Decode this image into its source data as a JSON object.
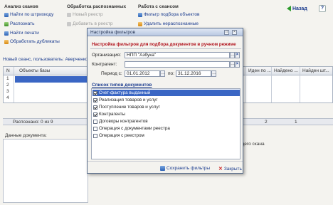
{
  "groups": [
    {
      "title": "Анализ сканов",
      "items": [
        "Найти по штрихкоду",
        "Распознать",
        "Найти печати",
        "Обработать дубликаты"
      ]
    },
    {
      "title": "Обработка распознанных",
      "items": [
        "Новый реестр",
        "Добавить в реестр"
      ]
    },
    {
      "title": "Работа с сеансом",
      "items": [
        "Фильтр подбора объектов",
        "Удалить нераспознанные"
      ]
    }
  ],
  "back": {
    "label": "Назад"
  },
  "help": {
    "label": "?"
  },
  "session": {
    "text": "Новый сеанс, пользователь: Аверченко А"
  },
  "grid": {
    "columns": [
      "N",
      "Объекты базы",
      "Иден по ...",
      "Найдено ...",
      "Найден шт..."
    ],
    "row_numbers": [
      "1",
      "2",
      "3",
      "4"
    ],
    "status": "Распознано: 0 из 9",
    "right_values": [
      "2",
      "1"
    ]
  },
  "data_label": "Данные документа:",
  "right_label": "щего скана",
  "dialog": {
    "title": "Настройка фильтров",
    "header": "Настройка фильтров для подбора документов в ручном режиме",
    "org_label": "Организация:",
    "org_value": "НПП \"Азбука\"",
    "contr_label": "Контрагент:",
    "contr_value": "",
    "period_label": "Период с:",
    "date_from": "01.01.2012",
    "po_label": "по:",
    "date_to": "31.12.2016",
    "list_title": "Список типов документов",
    "doc_types": [
      {
        "label": "Счет-фактура выданный",
        "checked": true,
        "selected": true
      },
      {
        "label": "Реализация товаров и услуг",
        "checked": true,
        "selected": false
      },
      {
        "label": "Поступление товаров и услуг",
        "checked": true,
        "selected": false
      },
      {
        "label": "Контрагенты",
        "checked": true,
        "selected": false
      },
      {
        "label": "Договоры контрагентов",
        "checked": false,
        "selected": false
      },
      {
        "label": "Операция с документами реестра",
        "checked": false,
        "selected": false
      },
      {
        "label": "Операция с реестром",
        "checked": false,
        "selected": false
      }
    ],
    "save_label": "Сохранить фильтры",
    "close_label": "Закрыть"
  }
}
